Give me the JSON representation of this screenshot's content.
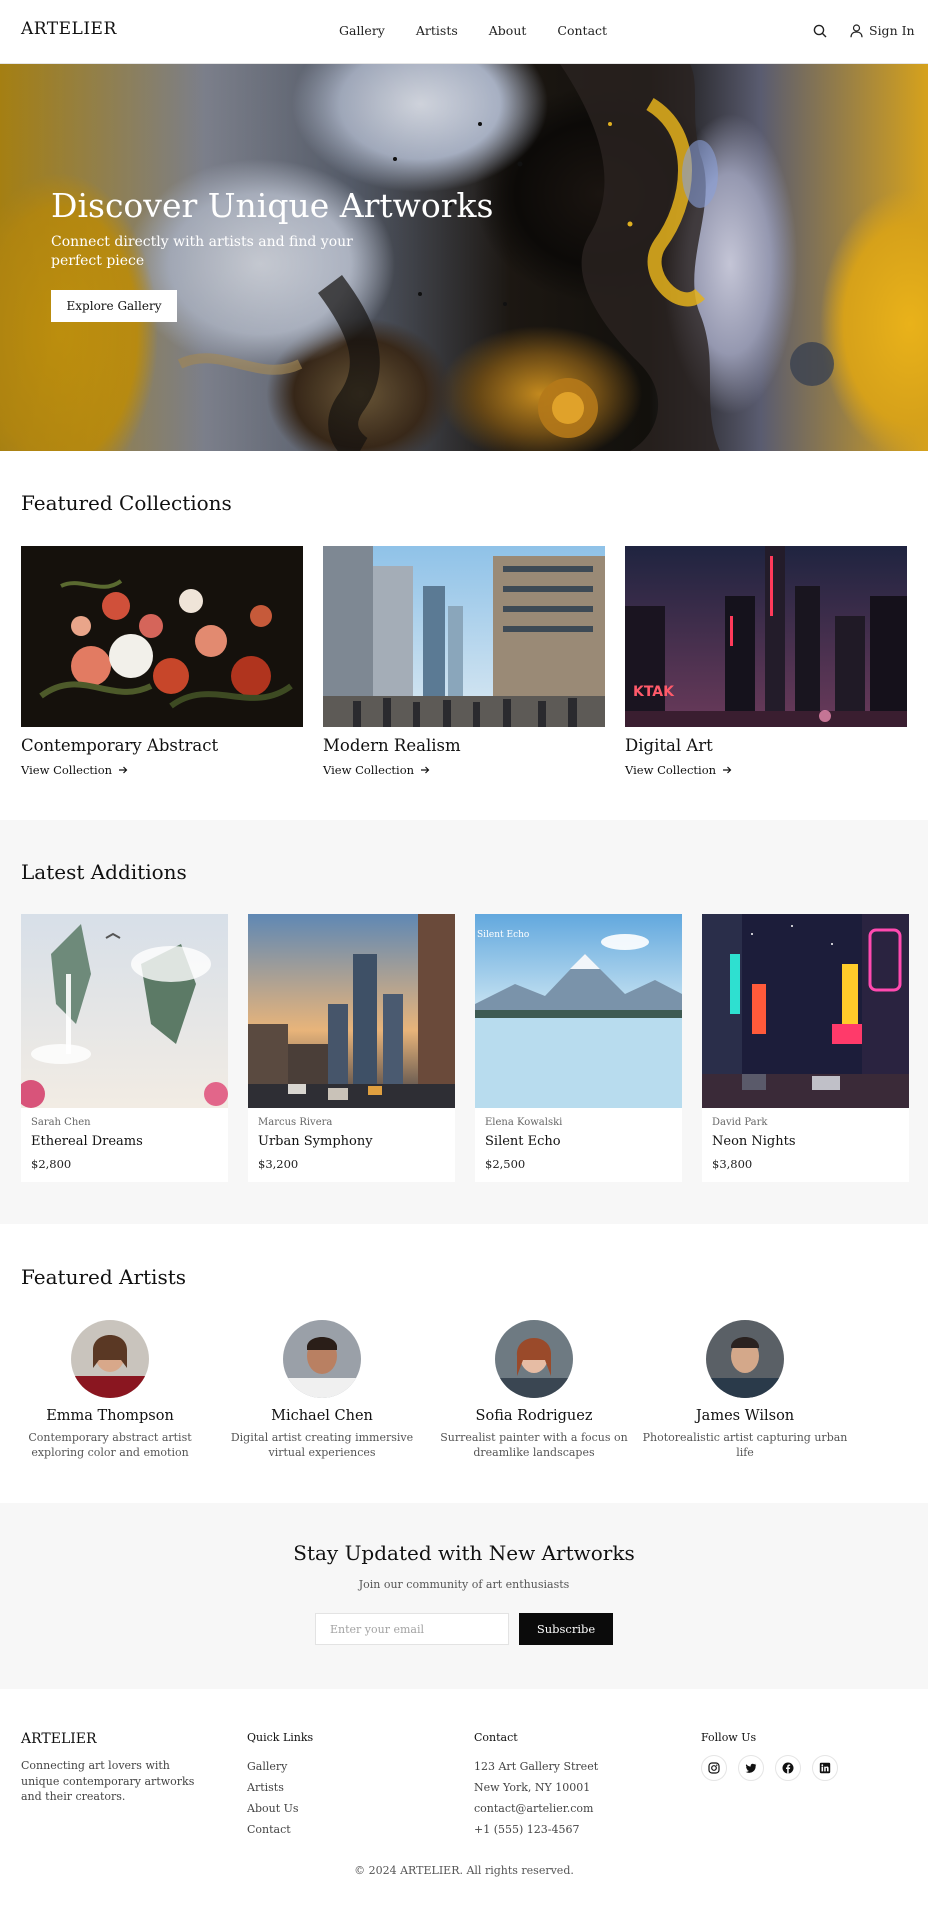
{
  "header": {
    "logo": "ARTELIER",
    "nav": [
      "Gallery",
      "Artists",
      "About",
      "Contact"
    ],
    "sign_in": "Sign In"
  },
  "hero": {
    "title": "Discover Unique Artworks",
    "subtitle": "Connect directly with artists and find your perfect piece",
    "button": "Explore Gallery"
  },
  "featured_collections": {
    "title": "Featured Collections",
    "link_label": "View Collection",
    "items": [
      {
        "name": "Contemporary Abstract"
      },
      {
        "name": "Modern Realism"
      },
      {
        "name": "Digital Art"
      }
    ]
  },
  "latest": {
    "title": "Latest Additions",
    "items": [
      {
        "artist": "Sarah Chen",
        "title": "Ethereal Dreams",
        "price": "$2,800",
        "image_caption": ""
      },
      {
        "artist": "Marcus Rivera",
        "title": "Urban Symphony",
        "price": "$3,200",
        "image_caption": ""
      },
      {
        "artist": "Elena Kowalski",
        "title": "Silent Echo",
        "price": "$2,500",
        "image_caption": "Silent Echo"
      },
      {
        "artist": "David Park",
        "title": "Neon Nights",
        "price": "$3,800",
        "image_caption": ""
      }
    ]
  },
  "artists": {
    "title": "Featured Artists",
    "items": [
      {
        "name": "Emma Thompson",
        "bio": "Contemporary abstract artist exploring color and emotion"
      },
      {
        "name": "Michael Chen",
        "bio": "Digital artist creating immersive virtual experiences"
      },
      {
        "name": "Sofia Rodriguez",
        "bio": "Surrealist painter with a focus on dreamlike landscapes"
      },
      {
        "name": "James Wilson",
        "bio": "Photorealistic artist capturing urban life"
      }
    ]
  },
  "newsletter": {
    "title": "Stay Updated with New Artworks",
    "subtitle": "Join our community of art enthusiasts",
    "placeholder": "Enter your email",
    "button": "Subscribe"
  },
  "footer": {
    "logo": "ARTELIER",
    "tagline": "Connecting art lovers with unique contemporary artworks and their creators.",
    "quick_links_title": "Quick Links",
    "quick_links": [
      "Gallery",
      "Artists",
      "About Us",
      "Contact"
    ],
    "contact_title": "Contact",
    "contact": [
      "123 Art Gallery Street",
      "New York, NY 10001",
      "contact@artelier.com",
      "+1 (555) 123-4567"
    ],
    "follow_title": "Follow Us",
    "social_icons": [
      "instagram-icon",
      "twitter-icon",
      "facebook-icon",
      "linkedin-icon"
    ],
    "copyright": "© 2024 ARTELIER. All rights reserved."
  },
  "colors": {
    "accent": "#0b0b0b",
    "section_bg": "#f7f7f7",
    "text": "#111111"
  }
}
